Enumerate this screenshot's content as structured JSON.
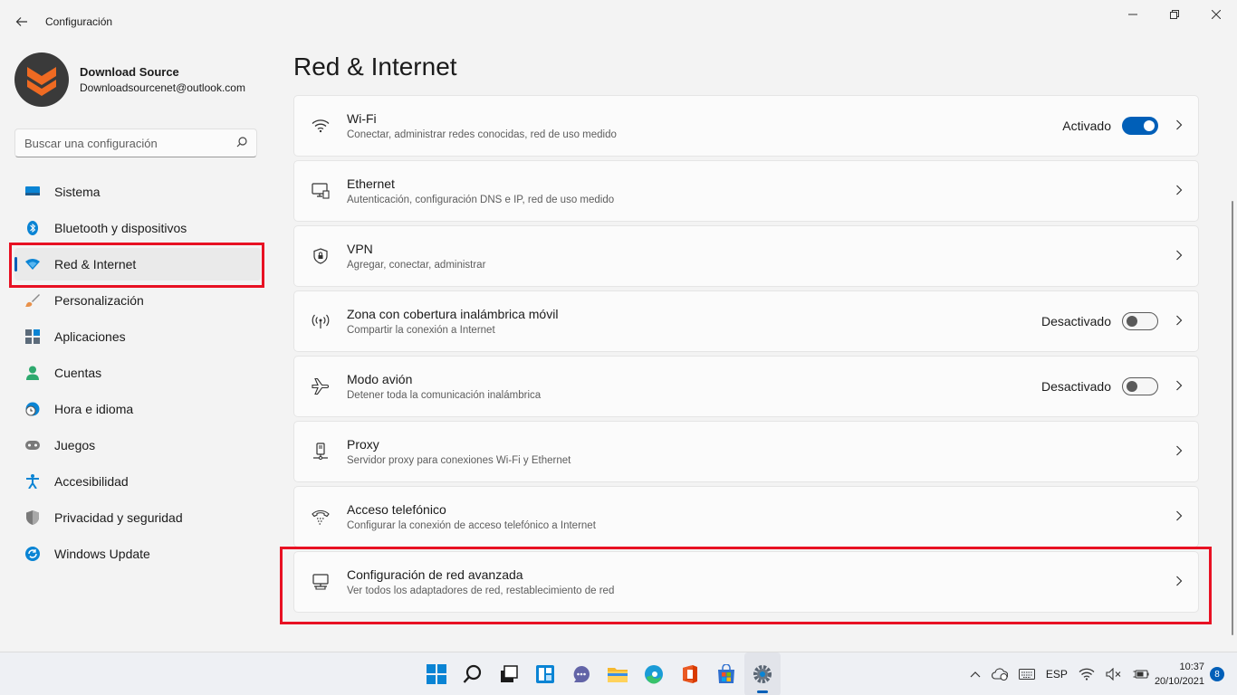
{
  "window": {
    "title": "Configuración",
    "back_icon": "back-arrow-icon"
  },
  "profile": {
    "name": "Download Source",
    "email": "Downloadsourcenet@outlook.com"
  },
  "search": {
    "placeholder": "Buscar una configuración"
  },
  "sidebar": {
    "items": [
      {
        "label": "Sistema",
        "icon": "monitor-icon",
        "color": "#0078d4"
      },
      {
        "label": "Bluetooth y dispositivos",
        "icon": "bluetooth-icon",
        "color": "#0078d4"
      },
      {
        "label": "Red & Internet",
        "icon": "wifi-icon",
        "color": "#0078d4",
        "active": true
      },
      {
        "label": "Personalización",
        "icon": "brush-icon",
        "color": "#e8914a"
      },
      {
        "label": "Aplicaciones",
        "icon": "apps-icon",
        "color": "#5c6b7a"
      },
      {
        "label": "Cuentas",
        "icon": "user-icon",
        "color": "#2ea96e"
      },
      {
        "label": "Hora e idioma",
        "icon": "clock-globe-icon",
        "color": "#0078d4"
      },
      {
        "label": "Juegos",
        "icon": "gamepad-icon",
        "color": "#6b6b6b"
      },
      {
        "label": "Accesibilidad",
        "icon": "accessibility-icon",
        "color": "#0078d4"
      },
      {
        "label": "Privacidad y seguridad",
        "icon": "shield-icon",
        "color": "#7a7a7a"
      },
      {
        "label": "Windows Update",
        "icon": "update-icon",
        "color": "#0078d4"
      }
    ]
  },
  "main": {
    "title": "Red & Internet",
    "cards": [
      {
        "title": "Wi-Fi",
        "desc": "Conectar, administrar redes conocidas, red de uso medido",
        "icon": "wifi-icon",
        "toggle_label": "Activado",
        "toggle": "on"
      },
      {
        "title": "Ethernet",
        "desc": "Autenticación, configuración DNS e IP, red de uso medido",
        "icon": "ethernet-icon"
      },
      {
        "title": "VPN",
        "desc": "Agregar, conectar, administrar",
        "icon": "vpn-shield-icon"
      },
      {
        "title": "Zona con cobertura inalámbrica móvil",
        "desc": "Compartir la conexión a Internet",
        "icon": "hotspot-icon",
        "toggle_label": "Desactivado",
        "toggle": "off"
      },
      {
        "title": "Modo avión",
        "desc": "Detener toda la comunicación inalámbrica",
        "icon": "airplane-icon",
        "toggle_label": "Desactivado",
        "toggle": "off"
      },
      {
        "title": "Proxy",
        "desc": "Servidor proxy para conexiones Wi-Fi y Ethernet",
        "icon": "proxy-icon"
      },
      {
        "title": "Acceso telefónico",
        "desc": "Configurar la conexión de acceso telefónico a Internet",
        "icon": "dialup-icon"
      },
      {
        "title": "Configuración de red avanzada",
        "desc": "Ver todos los adaptadores de red, restablecimiento de red",
        "icon": "network-adapter-icon"
      }
    ]
  },
  "taskbar": {
    "tray_lang": "ESP",
    "time": "10:37",
    "date": "20/10/2021",
    "notifications": "8"
  },
  "colors": {
    "accent": "#005fb8",
    "highlight": "#e81123"
  }
}
